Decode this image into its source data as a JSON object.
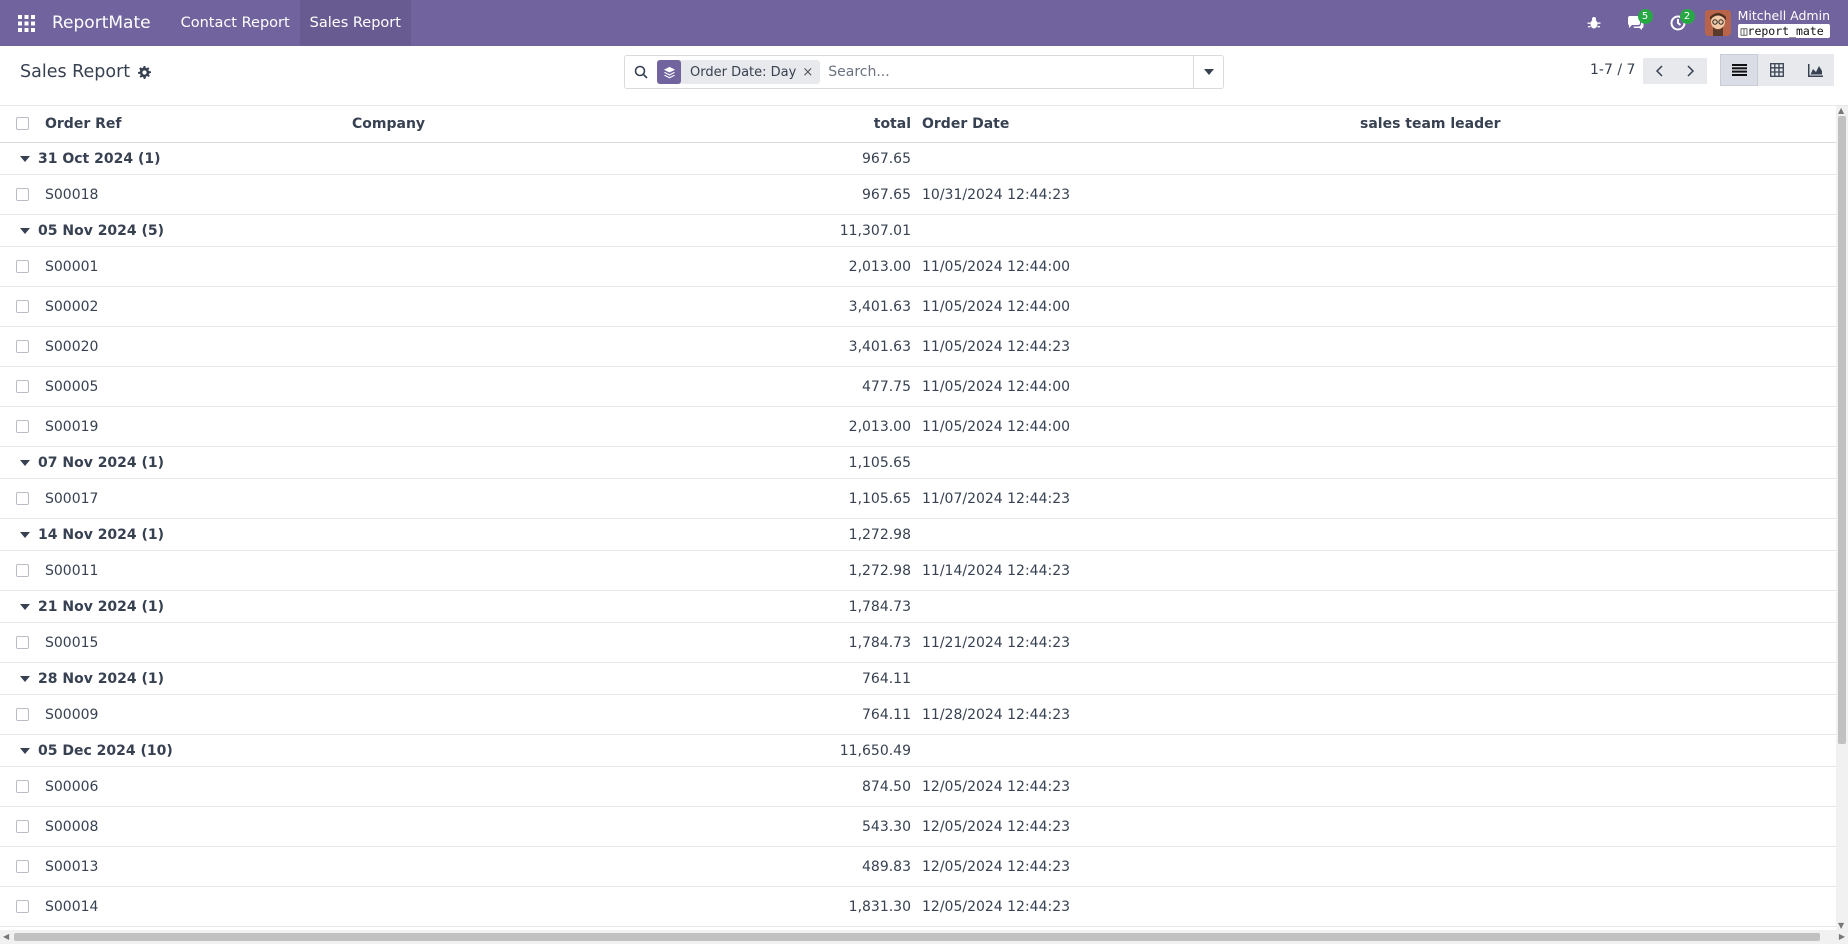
{
  "navbar": {
    "brand": "ReportMate",
    "menus": [
      "Contact Report",
      "Sales Report"
    ],
    "messages_count": "5",
    "activities_count": "2",
    "user_name": "Mitchell Admin",
    "database": "report_mate",
    "colors": {
      "bar": "#71639e",
      "counter": "#28a745"
    }
  },
  "control": {
    "title": "Sales Report",
    "facet_label": "Order Date: Day",
    "facet_remove": "×",
    "search_placeholder": "Search...",
    "pager": "1-7 / 7"
  },
  "list": {
    "columns": {
      "ref": "Order Ref",
      "company": "Company",
      "total": "total",
      "date": "Order Date",
      "leader": "sales team leader"
    },
    "groups": [
      {
        "label": "31 Oct 2024 (1)",
        "total": "967.65",
        "records": [
          {
            "ref": "S00018",
            "total": "967.65",
            "date": "10/31/2024 12:44:23"
          }
        ]
      },
      {
        "label": "05 Nov 2024 (5)",
        "total": "11,307.01",
        "records": [
          {
            "ref": "S00001",
            "total": "2,013.00",
            "date": "11/05/2024 12:44:00"
          },
          {
            "ref": "S00002",
            "total": "3,401.63",
            "date": "11/05/2024 12:44:00"
          },
          {
            "ref": "S00020",
            "total": "3,401.63",
            "date": "11/05/2024 12:44:23"
          },
          {
            "ref": "S00005",
            "total": "477.75",
            "date": "11/05/2024 12:44:00"
          },
          {
            "ref": "S00019",
            "total": "2,013.00",
            "date": "11/05/2024 12:44:00"
          }
        ]
      },
      {
        "label": "07 Nov 2024 (1)",
        "total": "1,105.65",
        "records": [
          {
            "ref": "S00017",
            "total": "1,105.65",
            "date": "11/07/2024 12:44:23"
          }
        ]
      },
      {
        "label": "14 Nov 2024 (1)",
        "total": "1,272.98",
        "records": [
          {
            "ref": "S00011",
            "total": "1,272.98",
            "date": "11/14/2024 12:44:23"
          }
        ]
      },
      {
        "label": "21 Nov 2024 (1)",
        "total": "1,784.73",
        "records": [
          {
            "ref": "S00015",
            "total": "1,784.73",
            "date": "11/21/2024 12:44:23"
          }
        ]
      },
      {
        "label": "28 Nov 2024 (1)",
        "total": "764.11",
        "records": [
          {
            "ref": "S00009",
            "total": "764.11",
            "date": "11/28/2024 12:44:23"
          }
        ]
      },
      {
        "label": "05 Dec 2024 (10)",
        "total": "11,650.49",
        "records": [
          {
            "ref": "S00006",
            "total": "874.50",
            "date": "12/05/2024 12:44:23"
          },
          {
            "ref": "S00008",
            "total": "543.30",
            "date": "12/05/2024 12:44:23"
          },
          {
            "ref": "S00013",
            "total": "489.83",
            "date": "12/05/2024 12:44:23"
          },
          {
            "ref": "S00014",
            "total": "1,831.30",
            "date": "12/05/2024 12:44:23"
          }
        ]
      }
    ]
  }
}
